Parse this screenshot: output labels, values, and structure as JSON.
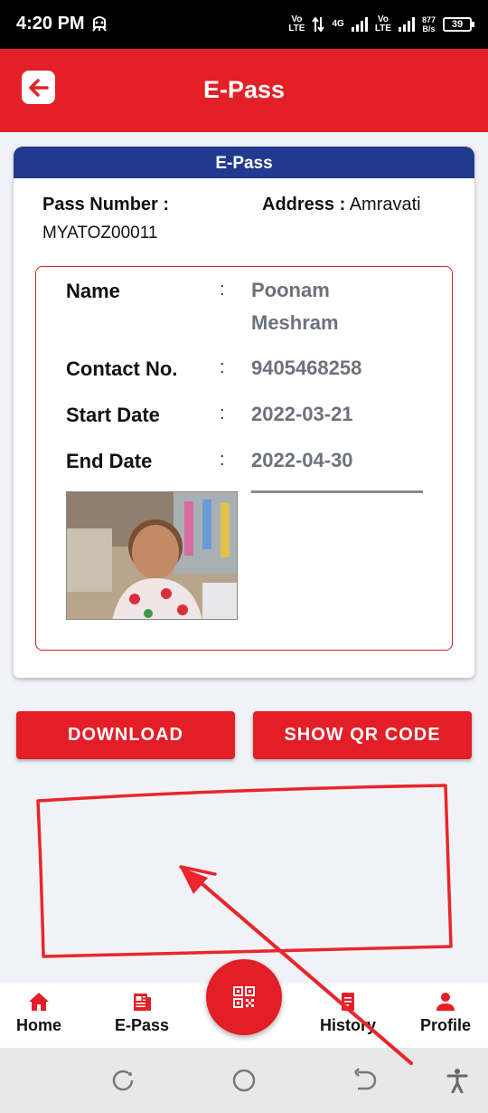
{
  "status_bar": {
    "time": "4:20 PM",
    "sim1": "Vo\nLTE",
    "net": "4G",
    "sim2": "Vo\nLTE",
    "speed_value": "877",
    "speed_unit": "B/s",
    "battery": "39"
  },
  "app_bar": {
    "title": "E-Pass",
    "back_icon": "arrow-left-icon"
  },
  "epass_card": {
    "header": "E-Pass",
    "pass_number_label": "Pass Number :",
    "pass_number_value": "MYATOZ00011",
    "address_label": "Address :",
    "address_value": "Amravati",
    "fields": [
      {
        "label": "Name",
        "colon": ":",
        "value_line1": "Poonam",
        "value_line2": "Meshram"
      },
      {
        "label": "Contact No.",
        "colon": ":",
        "value": "9405468258"
      },
      {
        "label": "Start Date",
        "colon": ":",
        "value": "2022-03-21"
      },
      {
        "label": "End Date",
        "colon": ":",
        "value": "2022-04-30"
      }
    ]
  },
  "actions": {
    "download": "DOWNLOAD",
    "show_qr": "SHOW QR CODE"
  },
  "bottom_nav": {
    "home": "Home",
    "epass": "E-Pass",
    "history": "History",
    "profile": "Profile",
    "fab_icon": "qr-code-icon"
  },
  "colors": {
    "primary_red": "#e32026",
    "card_header_blue": "#1f3a8e",
    "value_gray": "#6c727c"
  }
}
